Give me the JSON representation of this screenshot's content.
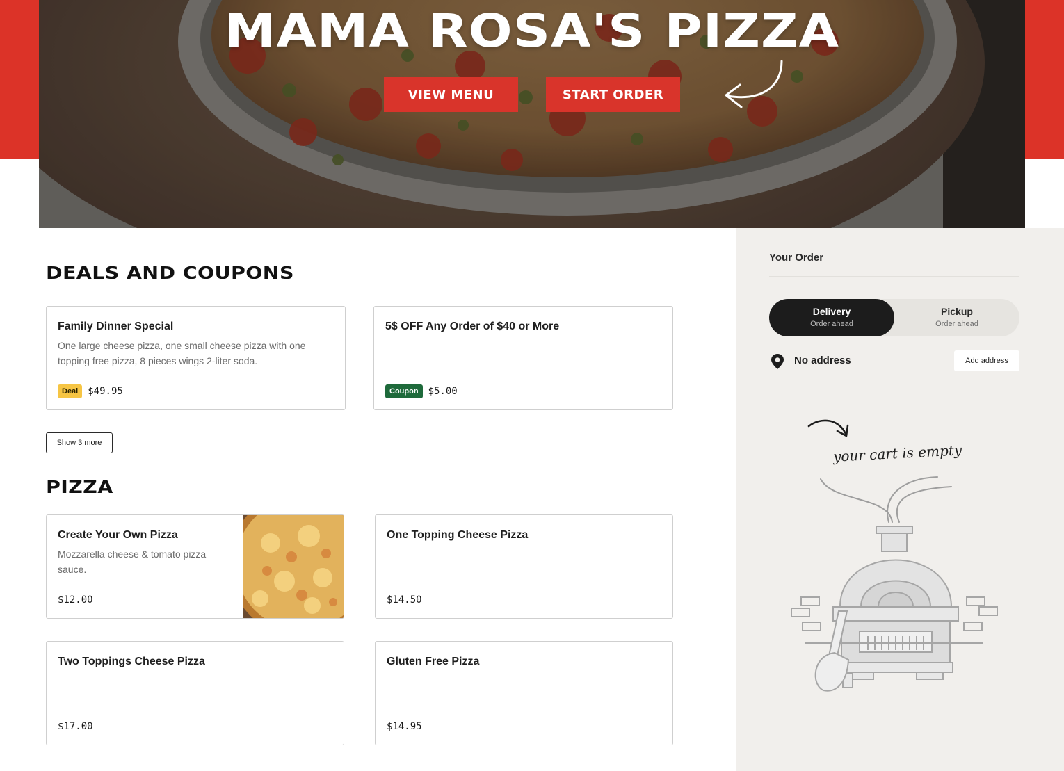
{
  "hero": {
    "title": "MAMA ROSA'S PIZZA",
    "view_menu_label": "VIEW MENU",
    "start_order_label": "START ORDER"
  },
  "deals": {
    "heading": "DEALS AND COUPONS",
    "items": [
      {
        "title": "Family Dinner Special",
        "description": "One large cheese pizza, one small cheese pizza with one topping free pizza, 8 pieces wings 2-liter soda.",
        "badge": "Deal",
        "price": "$49.95"
      },
      {
        "title": "5$ OFF Any Order of $40 or More",
        "description": "",
        "badge": "Coupon",
        "price": "$5.00"
      }
    ],
    "show_more_label": "Show 3 more"
  },
  "pizza": {
    "heading": "PIZZA",
    "items": [
      {
        "title": "Create Your Own Pizza",
        "description": "Mozzarella cheese & tomato pizza sauce.",
        "price": "$12.00",
        "has_image": true
      },
      {
        "title": "One Topping Cheese Pizza",
        "description": "",
        "price": "$14.50"
      },
      {
        "title": "Two Toppings Cheese Pizza",
        "description": "",
        "price": "$17.00"
      },
      {
        "title": "Gluten Free Pizza",
        "description": "",
        "price": "$14.95"
      }
    ]
  },
  "order": {
    "title": "Your Order",
    "delivery_label": "Delivery",
    "delivery_sub": "Order ahead",
    "pickup_label": "Pickup",
    "pickup_sub": "Order ahead",
    "address_text": "No address",
    "add_address_label": "Add address",
    "empty_cart_text": "your cart is empty"
  },
  "colors": {
    "brand_red": "#dc3328",
    "deal_badge": "#f6c544",
    "coupon_badge": "#1e6a3b",
    "sidebar_bg": "#f1efec",
    "toggle_active": "#1c1c1c"
  },
  "icons": {
    "arrow": "curved-arrow-icon",
    "pin": "location-pin-icon",
    "cart_arrow": "curved-arrow-icon",
    "oven": "pizza-oven-illustration"
  }
}
